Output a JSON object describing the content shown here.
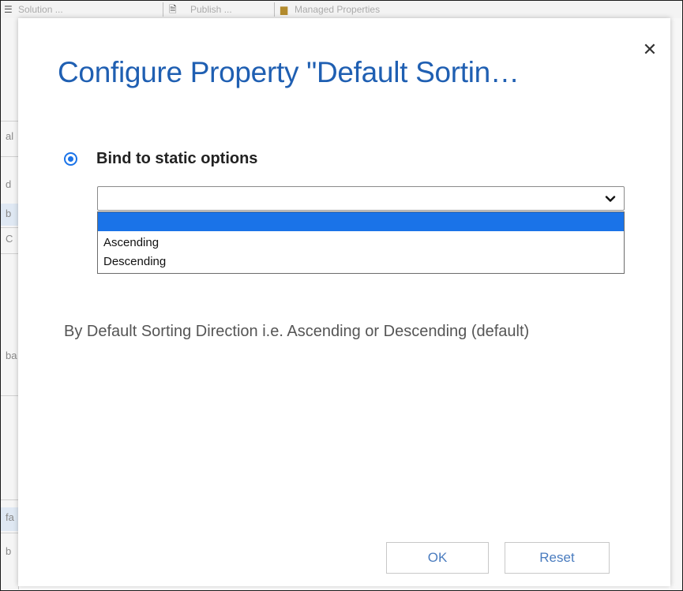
{
  "dialog": {
    "title": "Configure Property \"Default Sortin…",
    "close_icon": "close-icon",
    "close_glyph": "✕",
    "binding": {
      "radio_label": "Bind to static options",
      "selected": true
    },
    "select": {
      "current_value": "",
      "options": [
        {
          "label": "",
          "highlighted": true
        },
        {
          "label": "Ascending",
          "highlighted": false
        },
        {
          "label": "Descending",
          "highlighted": false
        }
      ]
    },
    "description": "By Default Sorting Direction i.e. Ascending or Descending (default)",
    "buttons": {
      "ok_label": "OK",
      "reset_label": "Reset"
    }
  },
  "background_app": {
    "toolbar": [
      {
        "label": "Solution ...",
        "icon": "list-icon"
      },
      {
        "label": "Publish ...",
        "icon": "document-icon"
      },
      {
        "label": "Managed Properties",
        "icon": "folder-icon"
      }
    ],
    "left_fragments": [
      "al",
      "d",
      "b",
      "C",
      "ba",
      "fa",
      "b"
    ]
  },
  "colors": {
    "title": "#1f5fb2",
    "accent": "#1a73e8",
    "button_text": "#4a7cbf",
    "description_text": "#555555"
  }
}
